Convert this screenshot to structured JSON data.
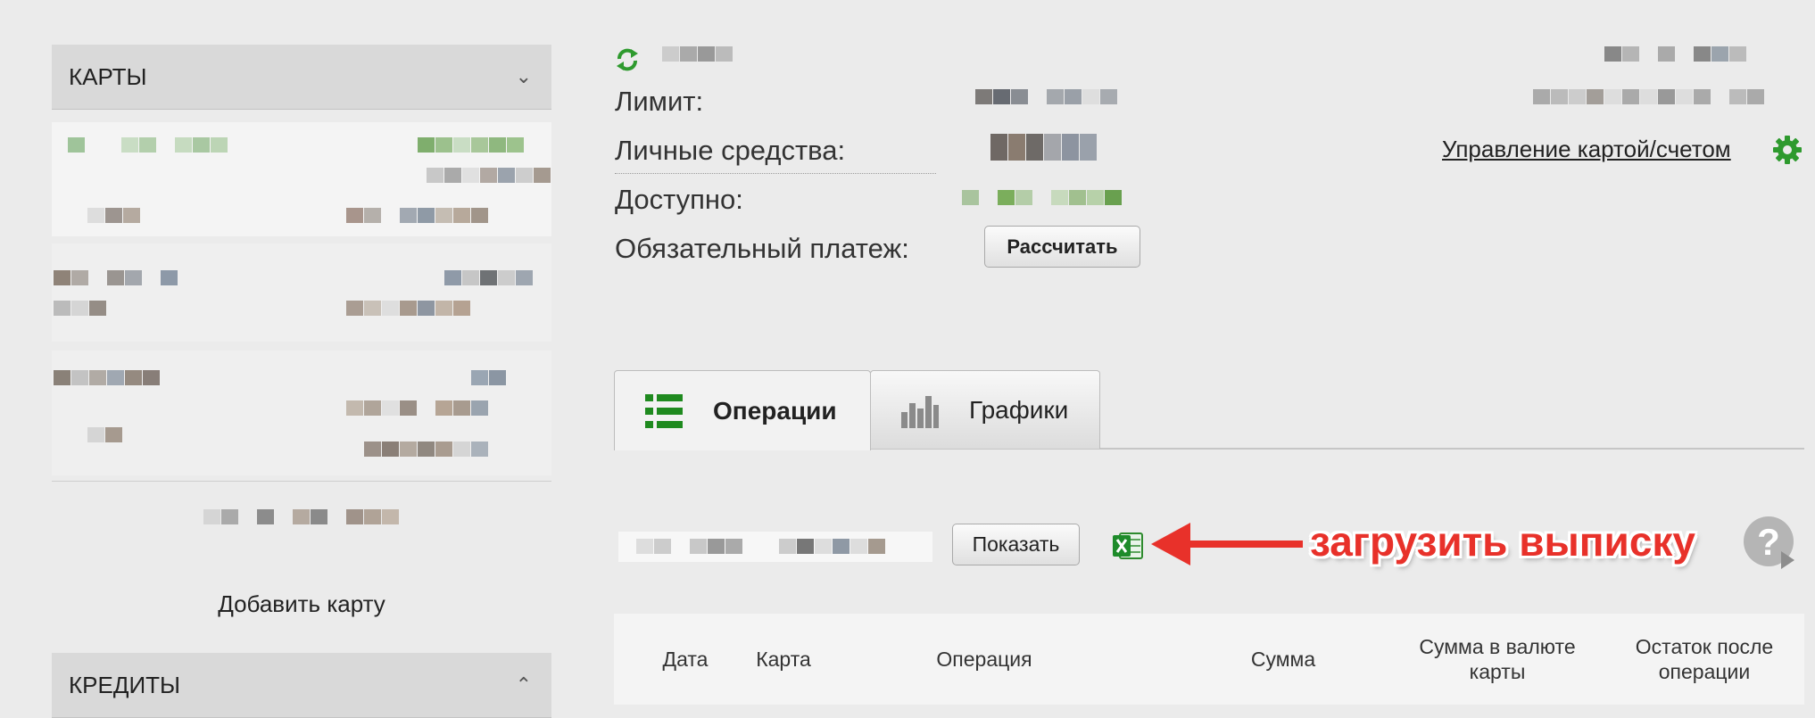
{
  "sidebar": {
    "cards_title": "КАРТЫ",
    "add_card": "Добавить карту",
    "credits_title": "КРЕДИТЫ"
  },
  "info": {
    "limit_label": "Лимит:",
    "own_funds_label": "Личные средства:",
    "available_label": "Доступно:",
    "mandatory_payment_label": "Обязательный платеж:",
    "calculate_button": "Рассчитать",
    "manage_link": "Управление картой/счетом"
  },
  "tabs": [
    {
      "label": "Операции",
      "icon": "list-icon",
      "active": true
    },
    {
      "label": "Графики",
      "icon": "bar-chart-icon",
      "active": false
    }
  ],
  "filter": {
    "show_button": "Показать",
    "excel_icon": "excel-icon",
    "help_icon": "help-icon"
  },
  "annotation": {
    "text": "загрузить выписку",
    "color": "#e8312a"
  },
  "table": {
    "columns": [
      "Дата",
      "Карта",
      "Операция",
      "Сумма",
      "Сумма в валюте карты",
      "Остаток после операции"
    ]
  },
  "colors": {
    "accent_green": "#2e9a2e",
    "background": "#ebebeb"
  }
}
